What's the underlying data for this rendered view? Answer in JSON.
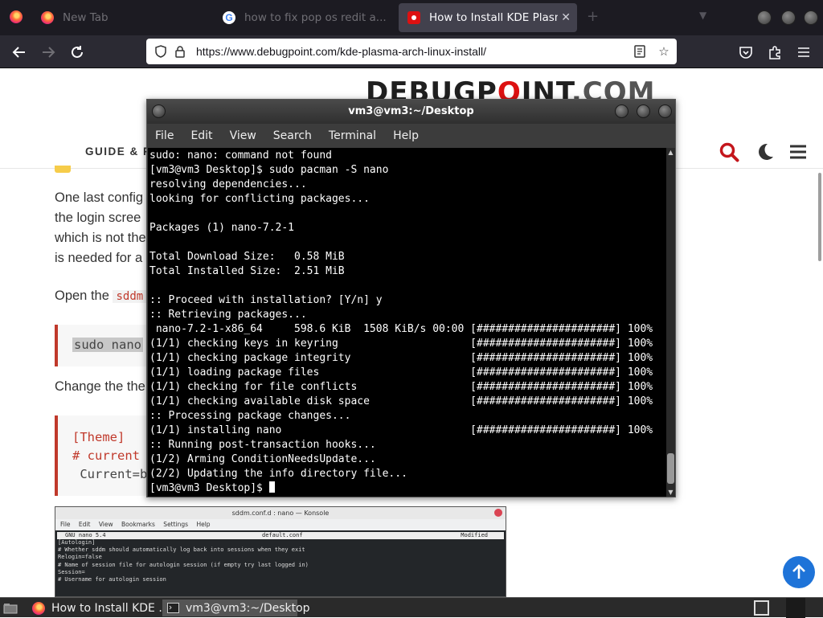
{
  "browser": {
    "tabs": [
      {
        "title": "New Tab",
        "icon": "firefox-icon",
        "active": false
      },
      {
        "title": "how to fix pop os redit a...",
        "icon": "google-icon",
        "active": false
      },
      {
        "title": "How to Install KDE Plasma i...",
        "icon": "debugpoint-icon",
        "active": true
      }
    ],
    "new_tab_symbol": "+",
    "url": "https://www.debugpoint.com/kde-plasma-arch-linux-install/",
    "icons": [
      "back-arrow-icon",
      "forward-arrow-icon",
      "reload-icon",
      "shield-icon",
      "lock-icon",
      "reader-view-icon",
      "bookmark-star-icon",
      "pocket-icon",
      "extensions-icon",
      "hamburger-menu-icon"
    ]
  },
  "page": {
    "logo_main": "DEBUGP",
    "logo_o": "O",
    "logo_rest": "INT",
    "logo_domain": ".COM",
    "nav_guide": "GUIDE & R",
    "para1": [
      "One last config",
      "the login scree",
      "which is not the",
      "is needed for a"
    ],
    "open_the": "Open the",
    "code_chip": "sddm",
    "code1": "sudo nano",
    "change_text": "Change the the",
    "code2": [
      "[Theme]",
      "# current",
      " Current=b"
    ],
    "screenshot": {
      "title": "sddm.conf.d : nano — Konsole",
      "menu": "File Edit View Bookmarks Settings Help",
      "nano_version": "GNU nano 5.4",
      "filename": "default.conf",
      "status": "Modified",
      "lines": [
        "[Autologin]",
        "# Whether sddm should automatically log back into sessions when they exit",
        "Relogin=false",
        "",
        "# Name of session file for autologin session (if empty try last logged in)",
        "Session=",
        "",
        "# Username for autologin session"
      ]
    }
  },
  "terminal": {
    "title": "vm3@vm3:~/Desktop",
    "menu": [
      "File",
      "Edit",
      "View",
      "Search",
      "Terminal",
      "Help"
    ],
    "lines": [
      "sudo: nano: command not found",
      "[vm3@vm3 Desktop]$ sudo pacman -S nano",
      "resolving dependencies...",
      "looking for conflicting packages...",
      "",
      "Packages (1) nano-7.2-1",
      "",
      "Total Download Size:   0.58 MiB",
      "Total Installed Size:  2.51 MiB",
      "",
      ":: Proceed with installation? [Y/n] y",
      ":: Retrieving packages...",
      " nano-7.2-1-x86_64     598.6 KiB  1508 KiB/s 00:00 [######################] 100%",
      "(1/1) checking keys in keyring                     [######################] 100%",
      "(1/1) checking package integrity                   [######################] 100%",
      "(1/1) loading package files                        [######################] 100%",
      "(1/1) checking for file conflicts                  [######################] 100%",
      "(1/1) checking available disk space                [######################] 100%",
      ":: Processing package changes...",
      "(1/1) installing nano                              [######################] 100%",
      ":: Running post-transaction hooks...",
      "(1/2) Arming ConditionNeedsUpdate...",
      "(2/2) Updating the info directory file..."
    ],
    "prompt": "[vm3@vm3 Desktop]$ "
  },
  "taskbar": {
    "tasks": [
      {
        "label": "How to Install KDE ...",
        "icon": "firefox-icon",
        "active": false
      },
      {
        "label": "vm3@vm3:~/Desktop",
        "icon": "terminal-icon",
        "active": true
      }
    ]
  },
  "colors": {
    "brand_red": "#dd1111",
    "accent_blue": "#1e73d8",
    "terminal_bg": "#000000"
  }
}
